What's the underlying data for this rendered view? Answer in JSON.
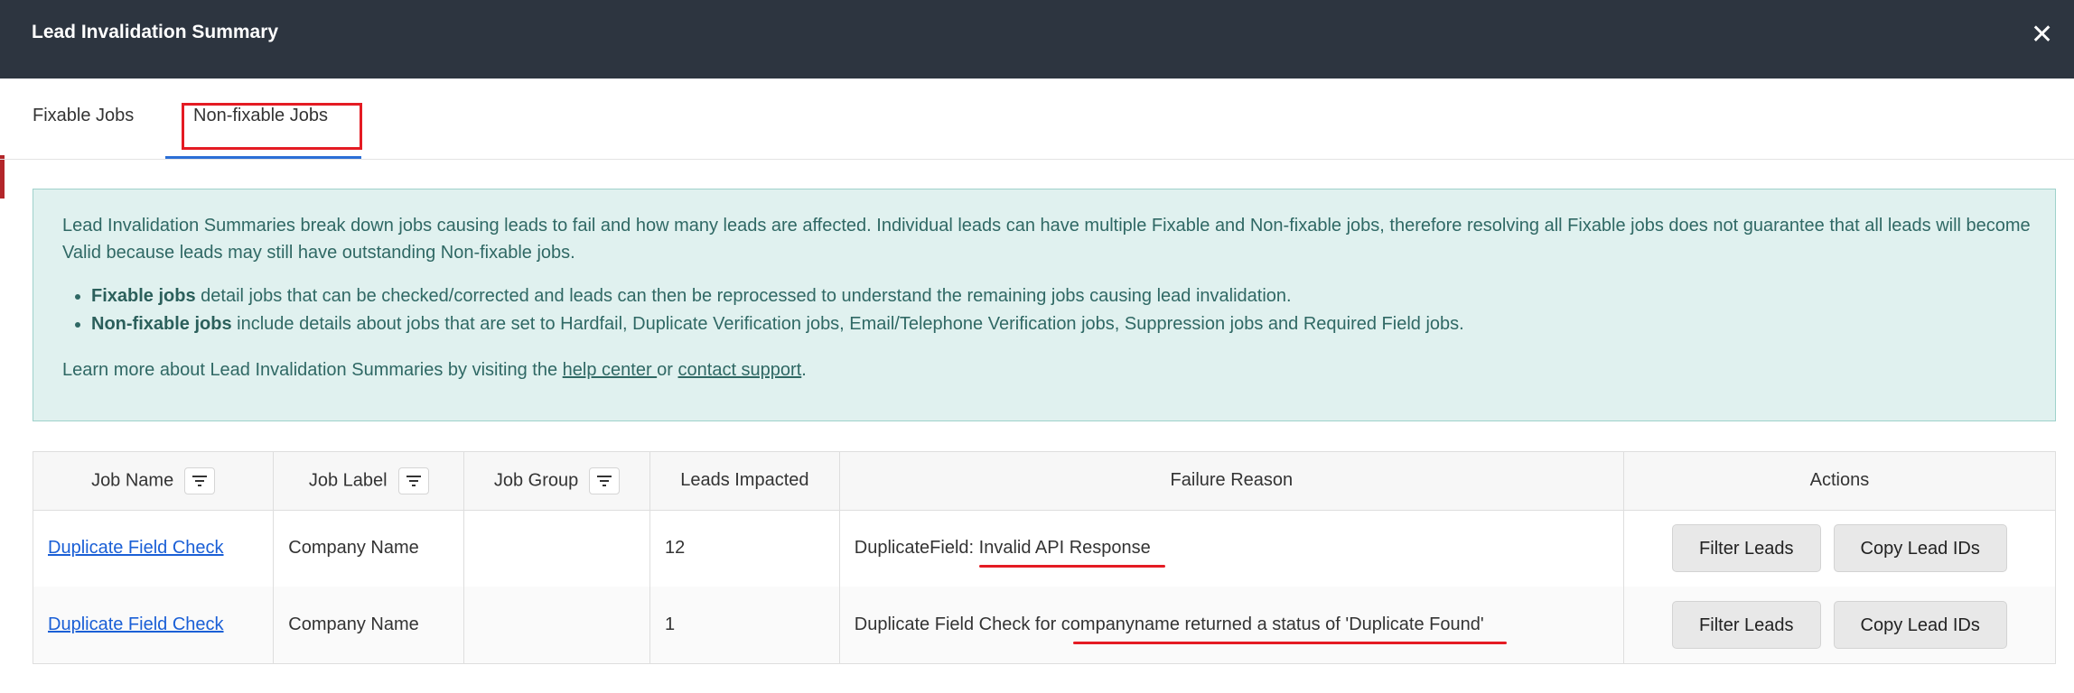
{
  "modal": {
    "title": "Lead Invalidation Summary",
    "close_glyph": "✕"
  },
  "tabs": [
    {
      "label": "Fixable Jobs"
    },
    {
      "label": "Non-fixable Jobs",
      "active": true
    }
  ],
  "info": {
    "intro": "Lead Invalidation Summaries break down jobs causing leads to fail and how many leads are affected. Individual leads can have multiple Fixable and Non-fixable jobs, therefore resolving all Fixable jobs does not guarantee that all leads will become Valid because leads may still have outstanding Non-fixable jobs.",
    "bullets": [
      {
        "term": "Fixable jobs",
        "text": " detail jobs that can be checked/corrected and leads can then be reprocessed to understand the remaining jobs causing lead invalidation."
      },
      {
        "term": "Non-fixable jobs",
        "text": " include details about jobs that are set to Hardfail, Duplicate Verification jobs, Email/Telephone Verification jobs, Suppression jobs and Required Field jobs."
      }
    ],
    "learn_prefix": "Learn more about Lead Invalidation Summaries by visiting the ",
    "help_link": "help center ",
    "or_text": "or ",
    "support_link": "contact support",
    "period": "."
  },
  "table": {
    "columns": [
      "Job Name",
      "Job Label",
      "Job Group",
      "Leads Impacted",
      "Failure Reason",
      "Actions"
    ],
    "rows": [
      {
        "job_name": "Duplicate Field Check",
        "job_label": "Company Name",
        "job_group": "",
        "leads": "12",
        "reason": "DuplicateField: Invalid API Response"
      },
      {
        "job_name": "Duplicate Field Check",
        "job_label": "Company Name",
        "job_group": "",
        "leads": "1",
        "reason": "Duplicate Field Check for companyname returned a status of 'Duplicate Found'"
      }
    ],
    "filter_button": "Filter Leads",
    "copy_button": "Copy Lead IDs"
  },
  "colors": {
    "header_bg": "#2d3540",
    "info_bg": "#e0f1ef",
    "link": "#1a5fd6",
    "annotation_red": "#e41b23"
  }
}
